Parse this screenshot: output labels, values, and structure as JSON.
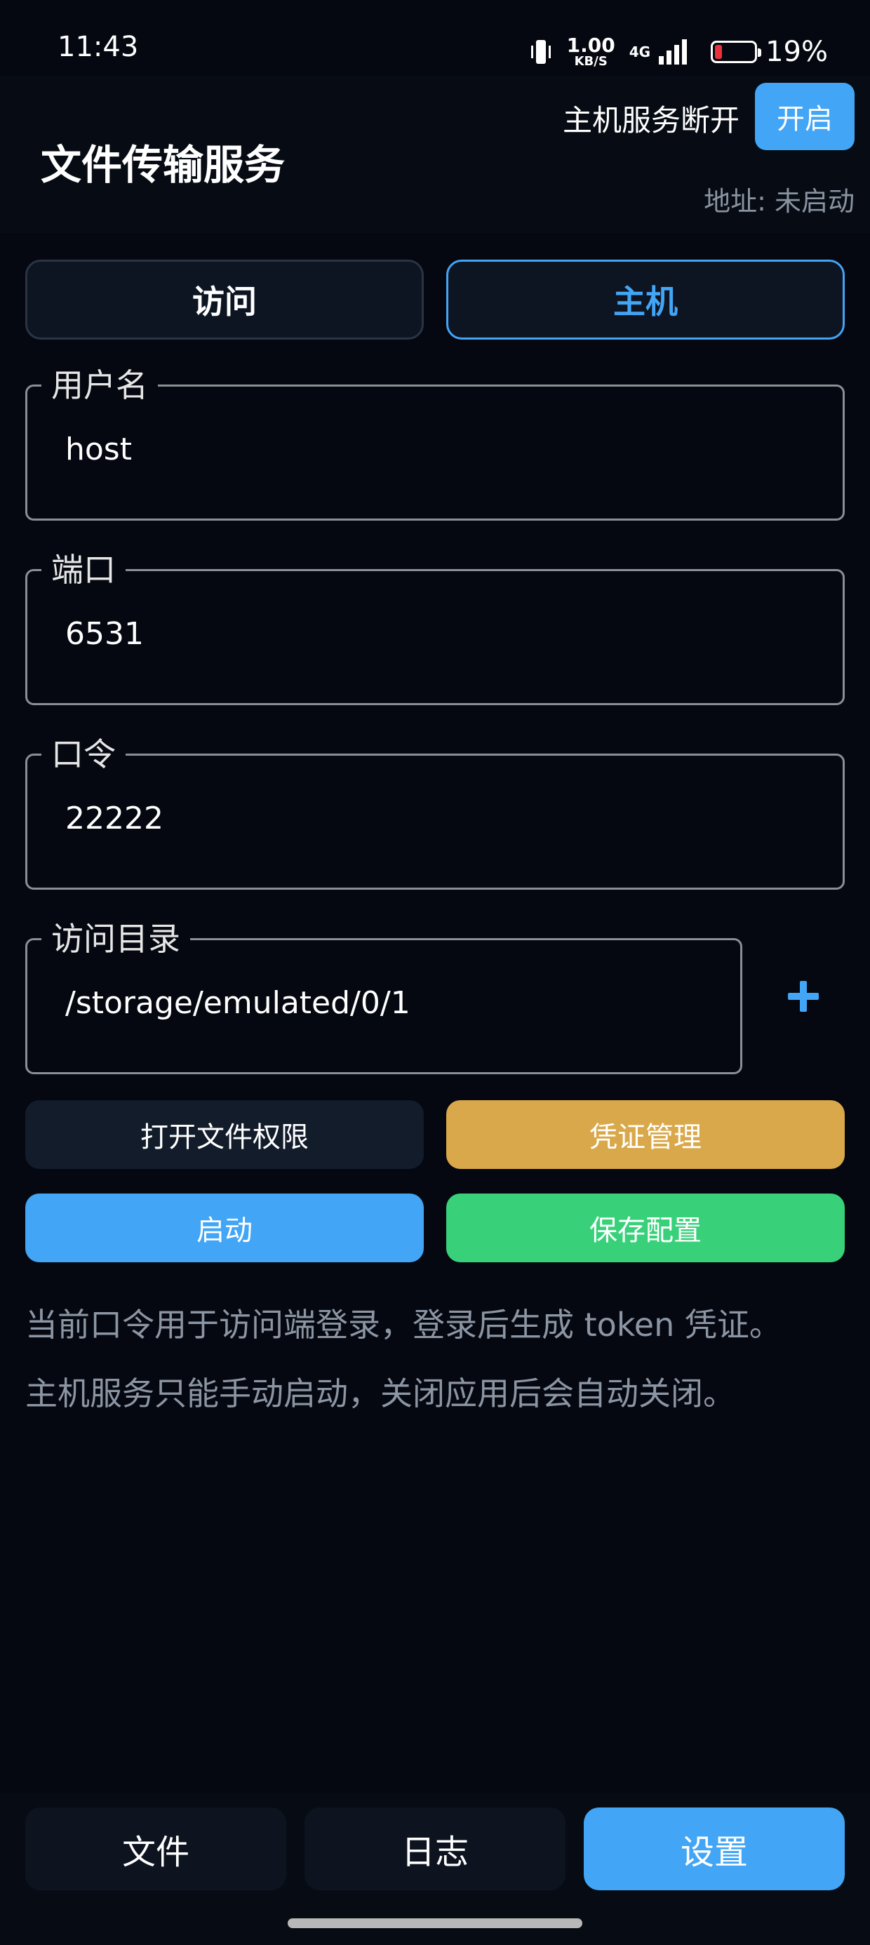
{
  "status_bar": {
    "time": "11:43",
    "net_speed_value": "1.00",
    "net_speed_unit": "KB/S",
    "network_type": "4G",
    "battery_percent": "19%",
    "battery_level": 0.19,
    "battery_color": "#e8333c"
  },
  "header": {
    "title": "文件传输服务",
    "host_status": "主机服务断开",
    "open_button": "开启",
    "address": "地址: 未启动"
  },
  "tabs": [
    {
      "label": "访问",
      "active": false
    },
    {
      "label": "主机",
      "active": true
    }
  ],
  "fields": {
    "username": {
      "label": "用户名",
      "value": "host"
    },
    "port": {
      "label": "端口",
      "value": "6531"
    },
    "password": {
      "label": "口令",
      "value": "22222"
    },
    "directory": {
      "label": "访问目录",
      "value": "/storage/emulated/0/1"
    }
  },
  "icons": {
    "add_directory": "plus-icon"
  },
  "buttons": {
    "open_permission": "打开文件权限",
    "credential_manage": "凭证管理",
    "start": "启动",
    "save_config": "保存配置"
  },
  "info": [
    "当前口令用于访问端登录，登录后生成 token 凭证。",
    "主机服务只能手动启动，关闭应用后会自动关闭。"
  ],
  "bottom_nav": [
    {
      "label": "文件",
      "active": false
    },
    {
      "label": "日志",
      "active": false
    },
    {
      "label": "设置",
      "active": true
    }
  ],
  "colors": {
    "accent": "#42a5f5",
    "credential": "#d9a84a",
    "save": "#38d17a",
    "background": "#050810"
  }
}
